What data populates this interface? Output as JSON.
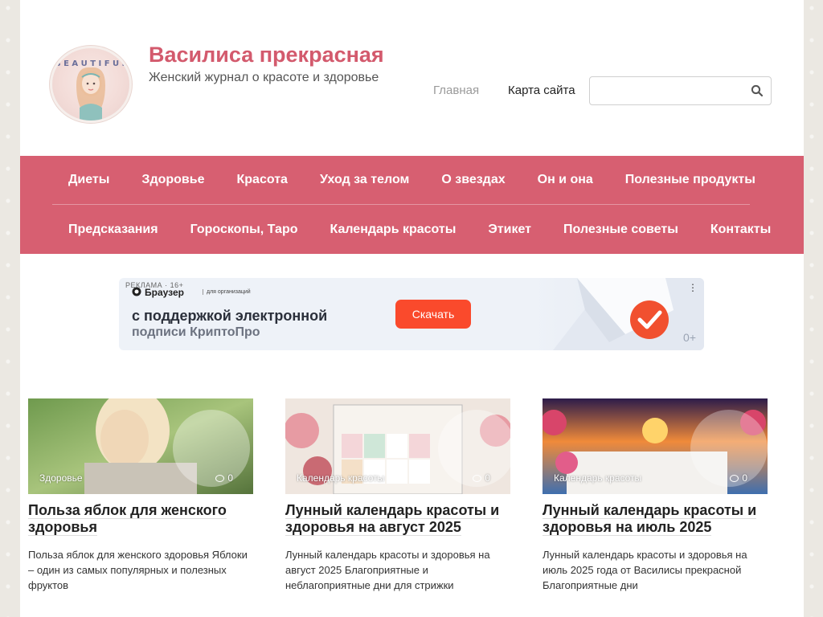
{
  "header": {
    "title": "Василиса прекрасная",
    "tagline": "Женский журнал о красоте и здоровье",
    "links": [
      "Главная",
      "Карта сайта"
    ],
    "search": {
      "placeholder": "",
      "value": "",
      "icon": "search-icon"
    },
    "logo_text": "BEAUTIFUL"
  },
  "nav": {
    "row1": [
      "Диеты",
      "Здоровье",
      "Красота",
      "Уход за телом",
      "О звездах",
      "Он и она",
      "Полезные продукты"
    ],
    "row2": [
      "Предсказания",
      "Гороскопы, Таро",
      "Календарь красоты",
      "Этикет",
      "Полезные советы",
      "Контакты"
    ]
  },
  "ad": {
    "label": "РЕКЛАМА · 16+",
    "brand": "Браузер",
    "brand_sub": "для организаций",
    "line1": "с поддержкой электронной",
    "line2": "подписи КриптоПро",
    "button": "Скачать",
    "age": "0+",
    "menu_icon": "more-vertical-icon"
  },
  "cards": [
    {
      "category": "Здоровье",
      "comments": "0",
      "title": "Польза яблок для женского здоровья",
      "excerpt": "Польза яблок для женского здоровья Яблоки – один из самых популярных и полезных фруктов"
    },
    {
      "category": "Календарь красоты",
      "comments": "0",
      "title": "Лунный календарь красоты и здоровья на август 2025",
      "excerpt": "Лунный календарь красоты и здоровья на август 2025 Благоприятные и неблагоприятные дни для стрижки"
    },
    {
      "category": "Календарь красоты",
      "comments": "0",
      "title": "Лунный календарь красоты и здоровья на июль 2025",
      "excerpt": "Лунный календарь красоты и здоровья на июль 2025 года от Василисы прекрасной Благоприятные дни"
    }
  ],
  "colors": {
    "accent": "#d75f71",
    "title": "#d35a6d",
    "ad_button": "#fa4a2c"
  }
}
